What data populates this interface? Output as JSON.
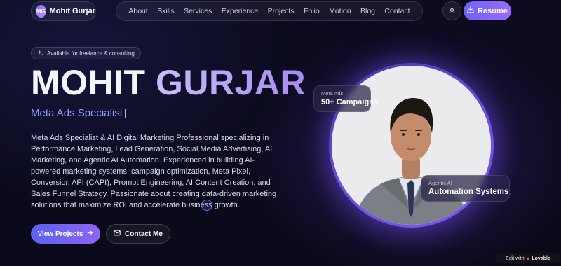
{
  "brand": {
    "initials": "MG",
    "name": "Mohit Gurjar"
  },
  "nav": {
    "links": [
      "About",
      "Skills",
      "Services",
      "Experience",
      "Projects",
      "Folio",
      "Motion",
      "Blog",
      "Contact"
    ],
    "resume_label": "Resume"
  },
  "hero": {
    "badge": "Available for freelance & consulting",
    "first_name": "MOHIT",
    "last_name": "GURJAR",
    "role": "Meta Ads Specialist",
    "role_cursor": "|",
    "description": "Meta Ads Specialist & AI Digital Marketing Professional specializing in Performance Marketing, Lead Generation, Social Media Advertising, AI Marketing, and Agentic AI Automation. Experienced in building AI-powered marketing systems, campaign optimization, Meta Pixel, Conversion API (CAPI), Prompt Engineering, AI Content Creation, and Sales Funnel Strategy. Passionate about creating data-driven marketing solutions that maximize ROI and accelerate business growth.",
    "primary_button": "View Projects",
    "secondary_button": "Contact Me"
  },
  "cards": {
    "meta_ads": {
      "label": "Meta Ads",
      "value": "50+ Campaigns"
    },
    "agentic_ai": {
      "label": "Agentic AI",
      "value": "Automation Systems"
    }
  },
  "footer_badge": {
    "prefix": "Edit with",
    "brand": "Lovable"
  },
  "colors": {
    "accent": "#7b5cf5",
    "role_text": "#8ba0ff",
    "background": "#0b0a1c"
  }
}
